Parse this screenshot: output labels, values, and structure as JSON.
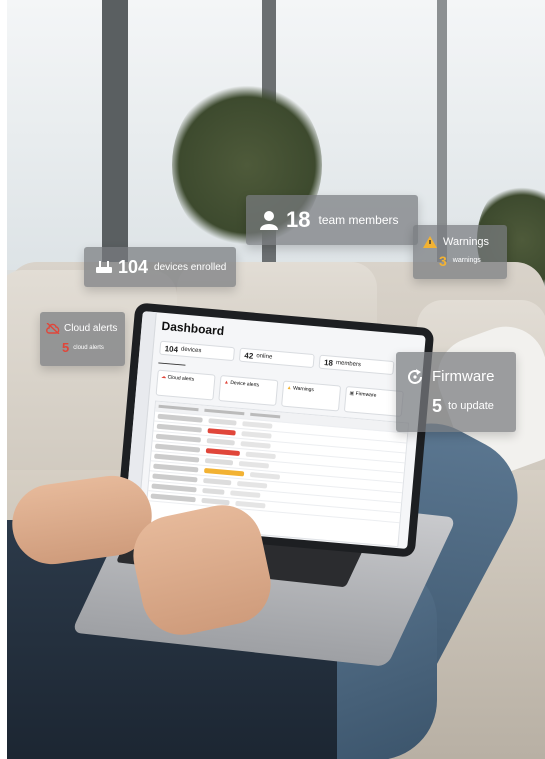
{
  "overlays": {
    "team": {
      "count": "18",
      "label": "team members",
      "icon": "person-icon"
    },
    "devices": {
      "count": "104",
      "label": "devices enrolled",
      "icon": "router-icon"
    },
    "warnings": {
      "title": "Warnings",
      "count": "3",
      "label": "warnings",
      "icon": "warning-icon"
    },
    "cloud": {
      "title": "Cloud alerts",
      "count": "5",
      "label": "cloud alerts",
      "icon": "cloud-off-icon"
    },
    "firmware": {
      "title": "Firmware",
      "count": "5",
      "label": "to update",
      "icon": "refresh-icon"
    }
  },
  "dashboard": {
    "title": "Dashboard",
    "chips": [
      {
        "count": "104",
        "label": "devices"
      },
      {
        "count": "42",
        "label": "online"
      },
      {
        "count": "18",
        "label": "members"
      }
    ],
    "cards": [
      "Cloud alerts",
      "Device alerts",
      "Warnings",
      "Firmware"
    ]
  },
  "colors": {
    "overlay_bg": "#7c8084",
    "warning": "#f2b233",
    "alert_red": "#e0463a",
    "accent_blue": "#2f7bd8"
  }
}
